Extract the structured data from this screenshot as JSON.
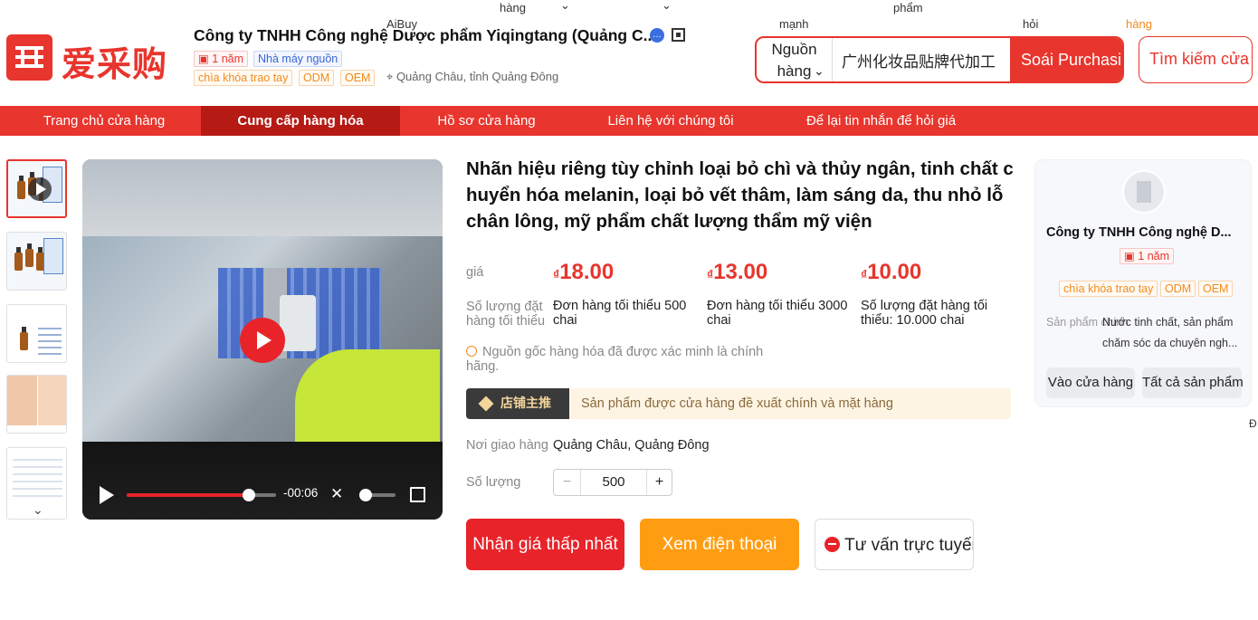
{
  "header": {
    "logo_text": "爱采购",
    "stray_labels": {
      "aibuy": "AiBuy",
      "hang1": "hàng",
      "manh": "mạnh",
      "pham": "phẩm",
      "hoi": "hỏi",
      "hang2": "hàng"
    },
    "company_name": "Công ty TNHH Công nghệ Dược phẩm Yiqingtang (Quảng C...",
    "tags": {
      "years": "1 năm",
      "source_factory": "Nhà máy nguồn",
      "turnkey": "chìa khóa trao tay",
      "odm": "ODM",
      "oem": "OEM"
    },
    "location": "Quảng Châu, tỉnh Quảng Đông",
    "search": {
      "source_label": "Nguồn hàng",
      "query": "广州化妆品贴牌代加工",
      "search_button": "Soái Purchasing",
      "secondary_button": "Tìm kiếm cửa hàng"
    }
  },
  "nav": {
    "items": [
      "Trang chủ cửa hàng",
      "Cung cấp hàng hóa",
      "Hồ sơ cửa hàng",
      "Liên hệ với chúng tôi",
      "Để lại tin nhắn để hỏi giá"
    ],
    "active_index": 1
  },
  "video": {
    "time_remaining": "-00:06",
    "progress": 0.82,
    "volume": 0.05
  },
  "product": {
    "title": "Nhãn hiệu riêng tùy chỉnh loại bỏ chì và thủy ngân, tinh chất chuyển hóa melanin, loại bỏ vết thâm, làm sáng da, thu nhỏ lỗ chân lông, mỹ phẩm chất lượng thẩm mỹ viện",
    "price_label": "giá",
    "currency": "₫",
    "prices": [
      "18.00",
      "13.00",
      "10.00"
    ],
    "moq_label": "Số lượng đặt hàng tối thiểu",
    "tiers": [
      "Đơn hàng tối thiểu 500 chai",
      "Đơn hàng tối thiểu 3000 chai",
      "Số lượng đặt hàng tối thiểu: 10.000 chai"
    ],
    "verified_text": "Nguồn gốc hàng hóa đã được xác minh là chính hãng.",
    "recommend_badge": "店铺主推",
    "recommend_text": "Sản phẩm được cửa hàng đề xuất chính và mặt hàng",
    "ship_label": "Nơi giao hàng",
    "ship_value": "Quảng Châu, Quảng Đông",
    "qty_label": "Số lượng",
    "qty_value": "500",
    "buttons": {
      "lowest_price": "Nhận giá thấp nhất",
      "view_phone": "Xem điện thoại",
      "consult": "Tư vấn trực tuyến"
    }
  },
  "store_card": {
    "name": "Công ty TNHH Công nghệ D...",
    "years": "1 năm",
    "tags": [
      "chìa khóa trao tay",
      "ODM",
      "OEM"
    ],
    "products_label": "Sản phẩm chính",
    "products_value": "Nước tinh chất, sản phẩm chăm sóc da chuyên ngh...",
    "visit_button": "Vào cửa hàng",
    "all_products_button": "Tất cả sản phẩm",
    "edge_label": "Đ"
  }
}
